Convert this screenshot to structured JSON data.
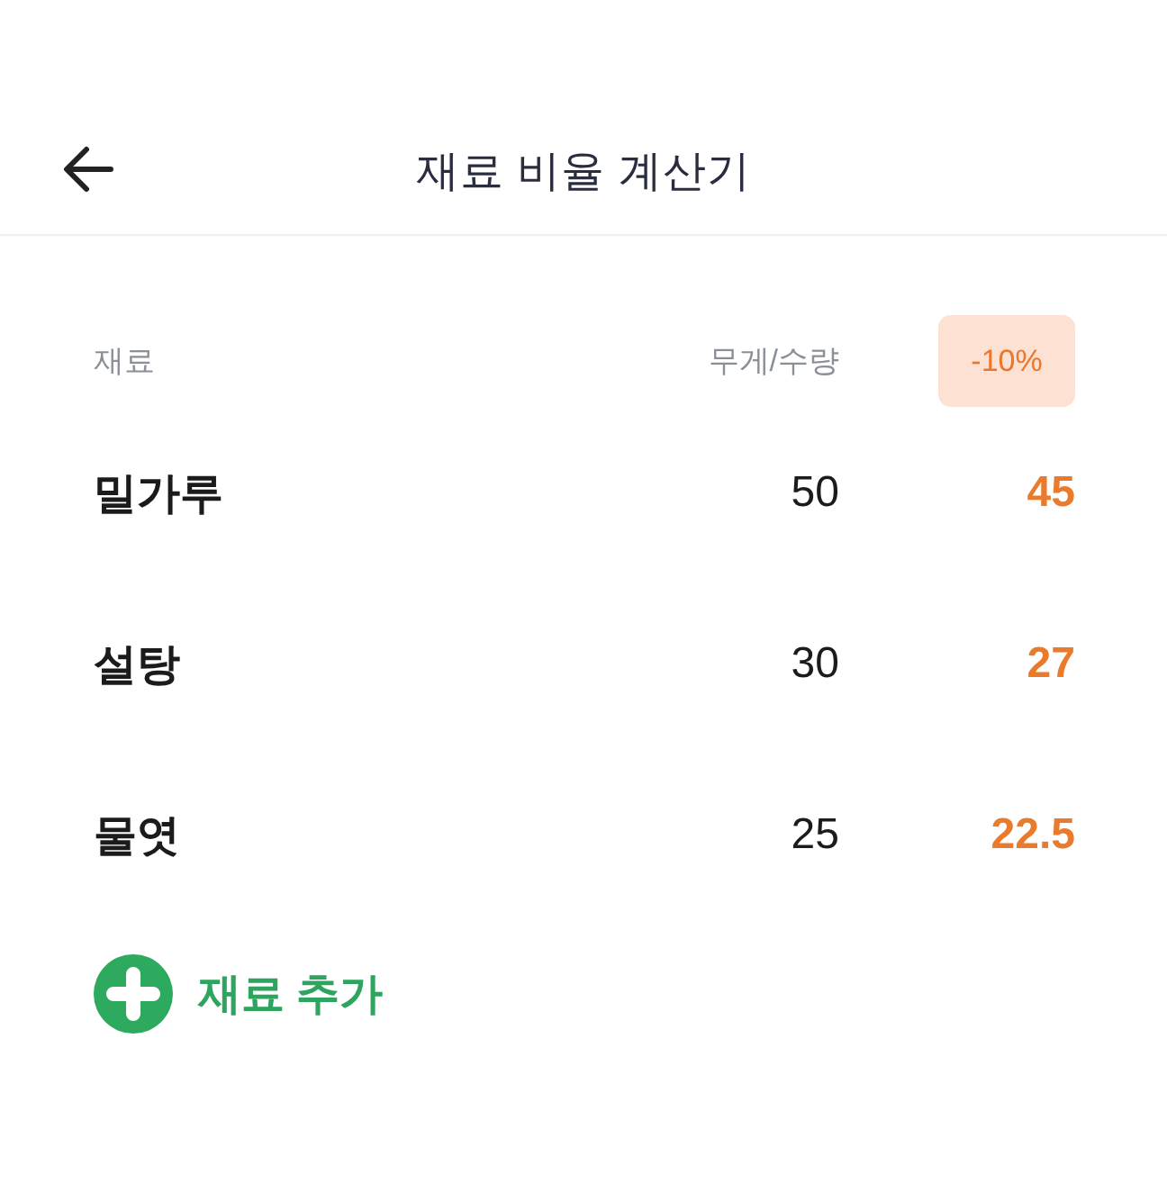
{
  "header": {
    "title": "재료 비율 계산기"
  },
  "table": {
    "columns": [
      {
        "label": "재료"
      },
      {
        "label": "무게/수량"
      }
    ],
    "adjustment": {
      "label": "-10%"
    },
    "rows": [
      {
        "name": "밀가루",
        "amount": "50",
        "adjusted": "45"
      },
      {
        "name": "설탕",
        "amount": "30",
        "adjusted": "27"
      },
      {
        "name": "물엿",
        "amount": "25",
        "adjusted": "22.5"
      }
    ]
  },
  "add_button": {
    "label": "재료 추가"
  }
}
